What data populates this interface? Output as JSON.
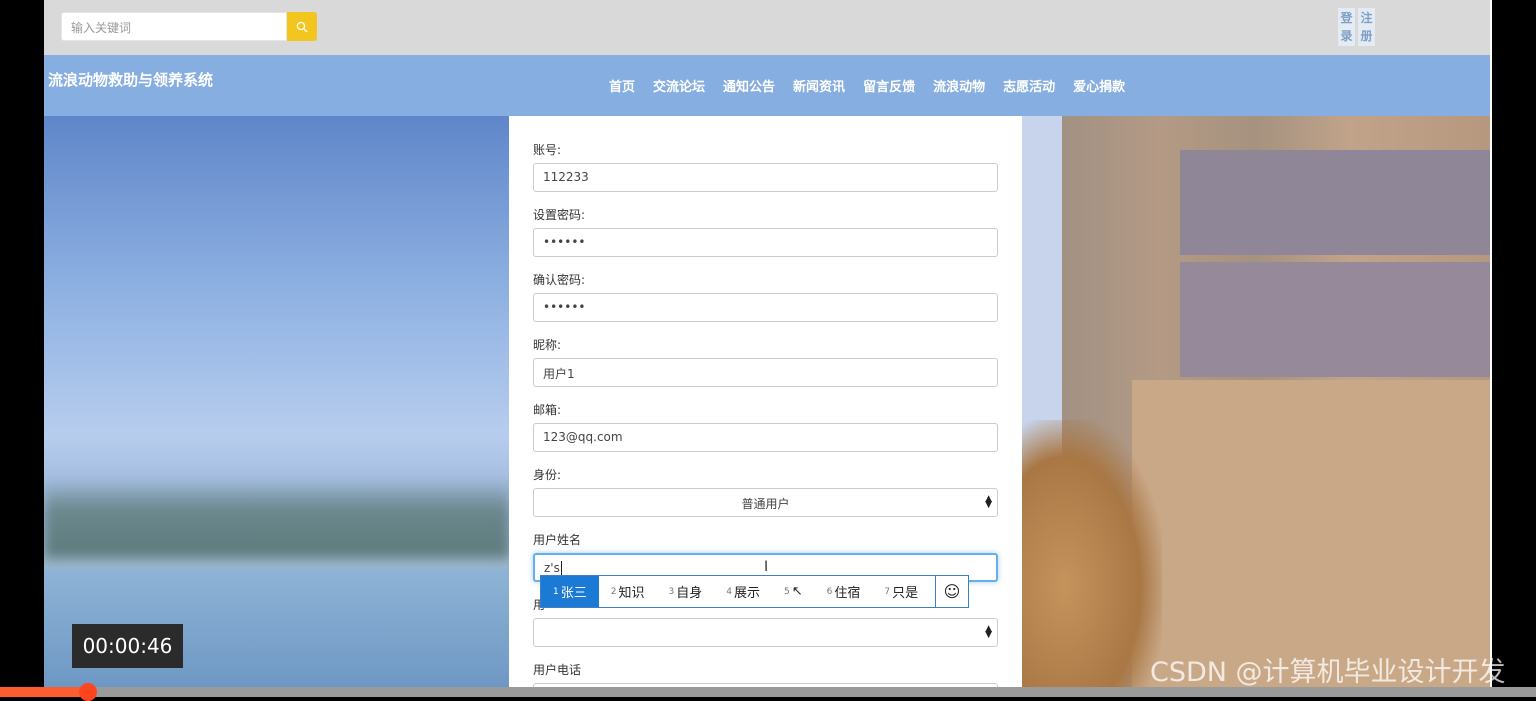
{
  "search": {
    "placeholder": "输入关键词",
    "icon": "search-icon"
  },
  "auth": {
    "login_label": "登录",
    "register_label": "注册"
  },
  "brand": {
    "title": "流浪动物救助与领养系统"
  },
  "nav": {
    "items": [
      "首页",
      "交流论坛",
      "通知公告",
      "新闻资讯",
      "留言反馈",
      "流浪动物",
      "志愿活动",
      "爱心捐款"
    ]
  },
  "form": {
    "account": {
      "label": "账号:",
      "value": "112233"
    },
    "password": {
      "label": "设置密码:",
      "value": "••••••"
    },
    "confirm_password": {
      "label": "确认密码:",
      "value": "••••••"
    },
    "nickname": {
      "label": "昵称:",
      "value": "用户1"
    },
    "email": {
      "label": "邮箱:",
      "value": "123@qq.com"
    },
    "identity": {
      "label": "身份:",
      "value": "普通用户"
    },
    "real_name": {
      "label": "用户姓名",
      "value": "z's"
    },
    "gender": {
      "label": "用",
      "value": ""
    },
    "phone": {
      "label": "用户电话"
    }
  },
  "ime": {
    "candidates": [
      {
        "num": "1",
        "text": "张三",
        "active": true
      },
      {
        "num": "2",
        "text": "知识"
      },
      {
        "num": "3",
        "text": "自身"
      },
      {
        "num": "4",
        "text": "展示"
      },
      {
        "num": "5",
        "text": "↖"
      },
      {
        "num": "6",
        "text": "住宿"
      },
      {
        "num": "7",
        "text": "只是"
      }
    ],
    "emoji_icon": "smiley-icon",
    "emoji_glyph": "☺"
  },
  "video": {
    "timestamp": "00:00:46",
    "progress_fraction": 0.057
  },
  "watermark": {
    "text": "CSDN @计算机毕业设计开发"
  },
  "colors": {
    "navbar": "#86aee0",
    "search_button": "#f2c61f",
    "ime_active": "#1a7ad4",
    "progress": "#fb5d2f"
  }
}
